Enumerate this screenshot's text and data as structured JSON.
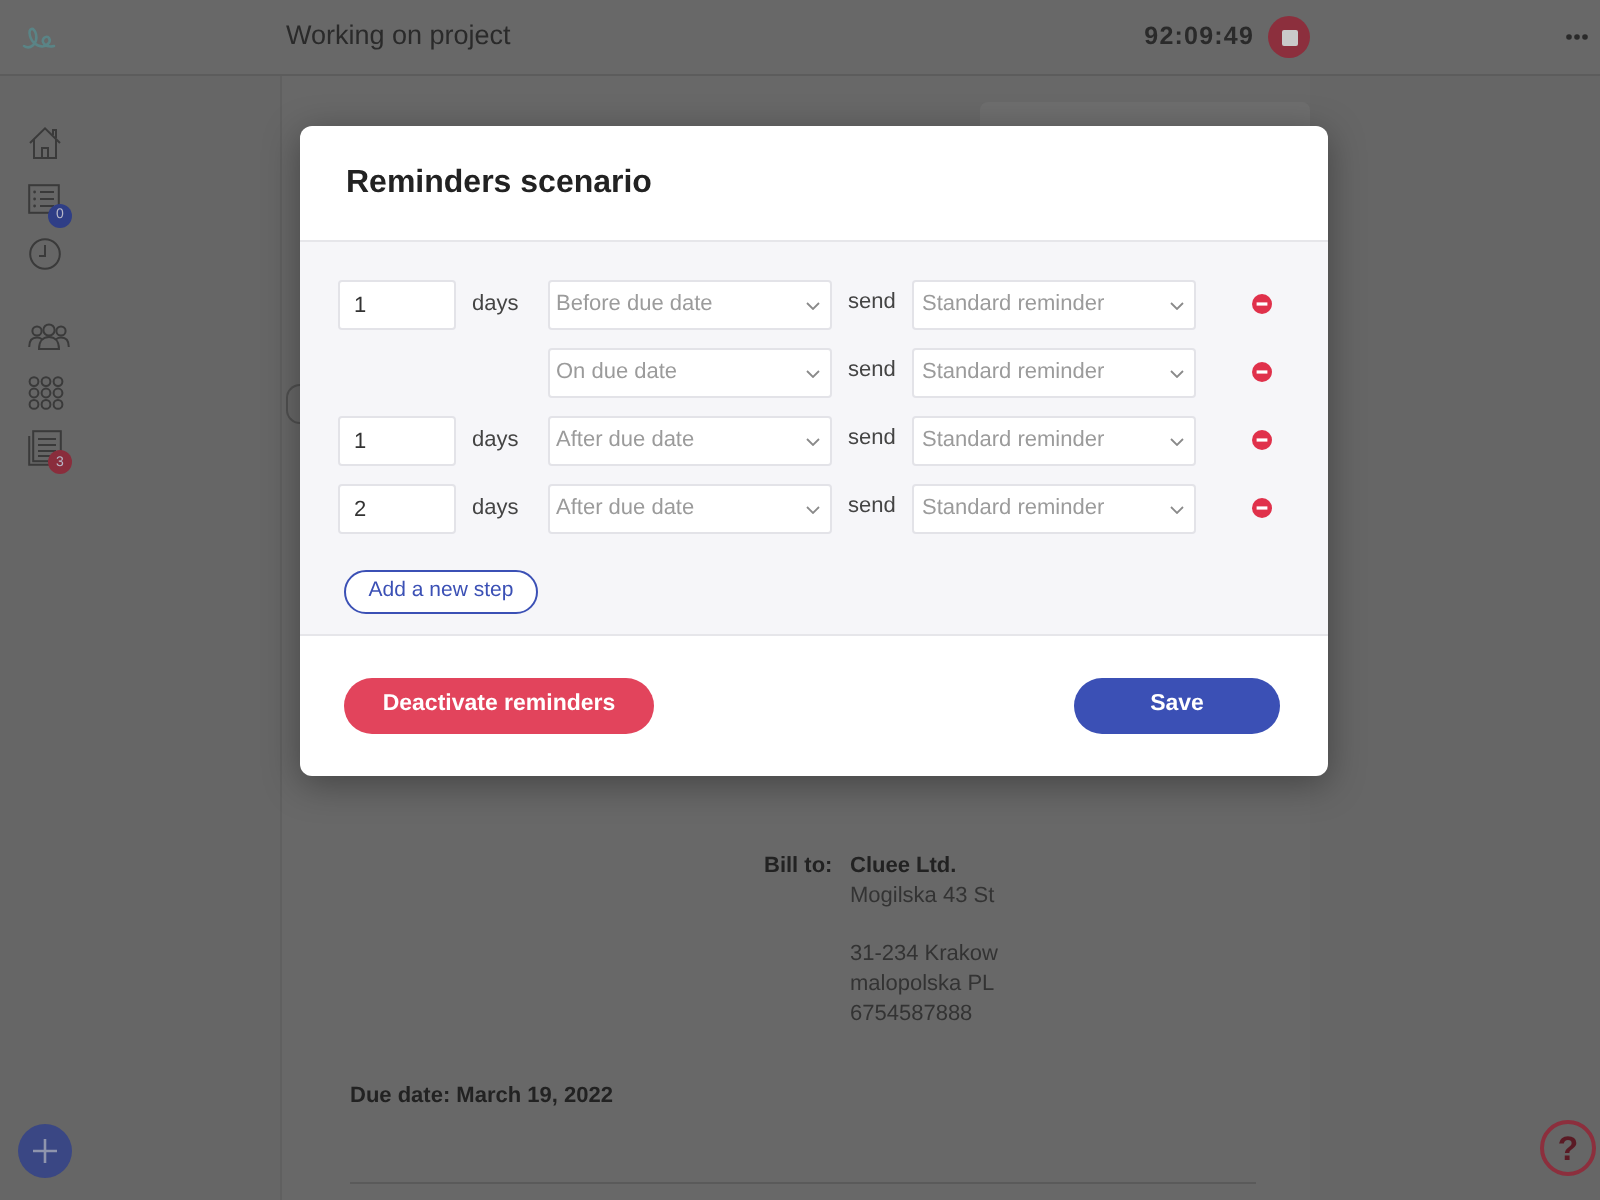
{
  "top_bar": {
    "title": "Working on project",
    "timer": "92:09:49"
  },
  "sidebar": {
    "groups": [
      {
        "items": [
          {
            "kind": "home"
          },
          {
            "kind": "list",
            "badge": "0",
            "color": "#2f3e86"
          },
          {
            "kind": "clock"
          }
        ]
      },
      {
        "items": [
          {
            "kind": "people"
          },
          {
            "kind": "apps"
          },
          {
            "kind": "document",
            "badge": "3",
            "color": "#8a2d3c"
          }
        ]
      }
    ]
  },
  "document": {
    "bill_to": {
      "label": "Bill to:",
      "name": "Cluee Ltd.",
      "address_blocks": [
        [
          "Mogilska 43 St"
        ],
        [
          "31-234 Krakow",
          "malopolska PL",
          "6754587888"
        ]
      ]
    },
    "due_date": "Due date: March 19, 2022"
  },
  "modal": {
    "title": "Reminders scenario",
    "steps": [
      {
        "kind": "offset",
        "days": "1",
        "days_label": "days",
        "timing": "Before due date",
        "send_label": "send",
        "reminder": "Standard reminder"
      },
      {
        "kind": "on_date",
        "timing": "On due date",
        "send_label": "send",
        "reminder": "Standard reminder"
      },
      {
        "kind": "offset",
        "days": "1",
        "days_label": "days",
        "timing": "After due date",
        "send_label": "send",
        "reminder": "Standard reminder"
      },
      {
        "kind": "offset",
        "days": "2",
        "days_label": "days",
        "timing": "After due date",
        "send_label": "send",
        "reminder": "Standard reminder"
      }
    ],
    "add_step": "Add a new step",
    "buttons": [
      {
        "kind": "danger",
        "label": "Deactivate reminders"
      },
      {
        "kind": "primary",
        "label": "Save"
      }
    ]
  },
  "help_button": {
    "label": "?"
  }
}
